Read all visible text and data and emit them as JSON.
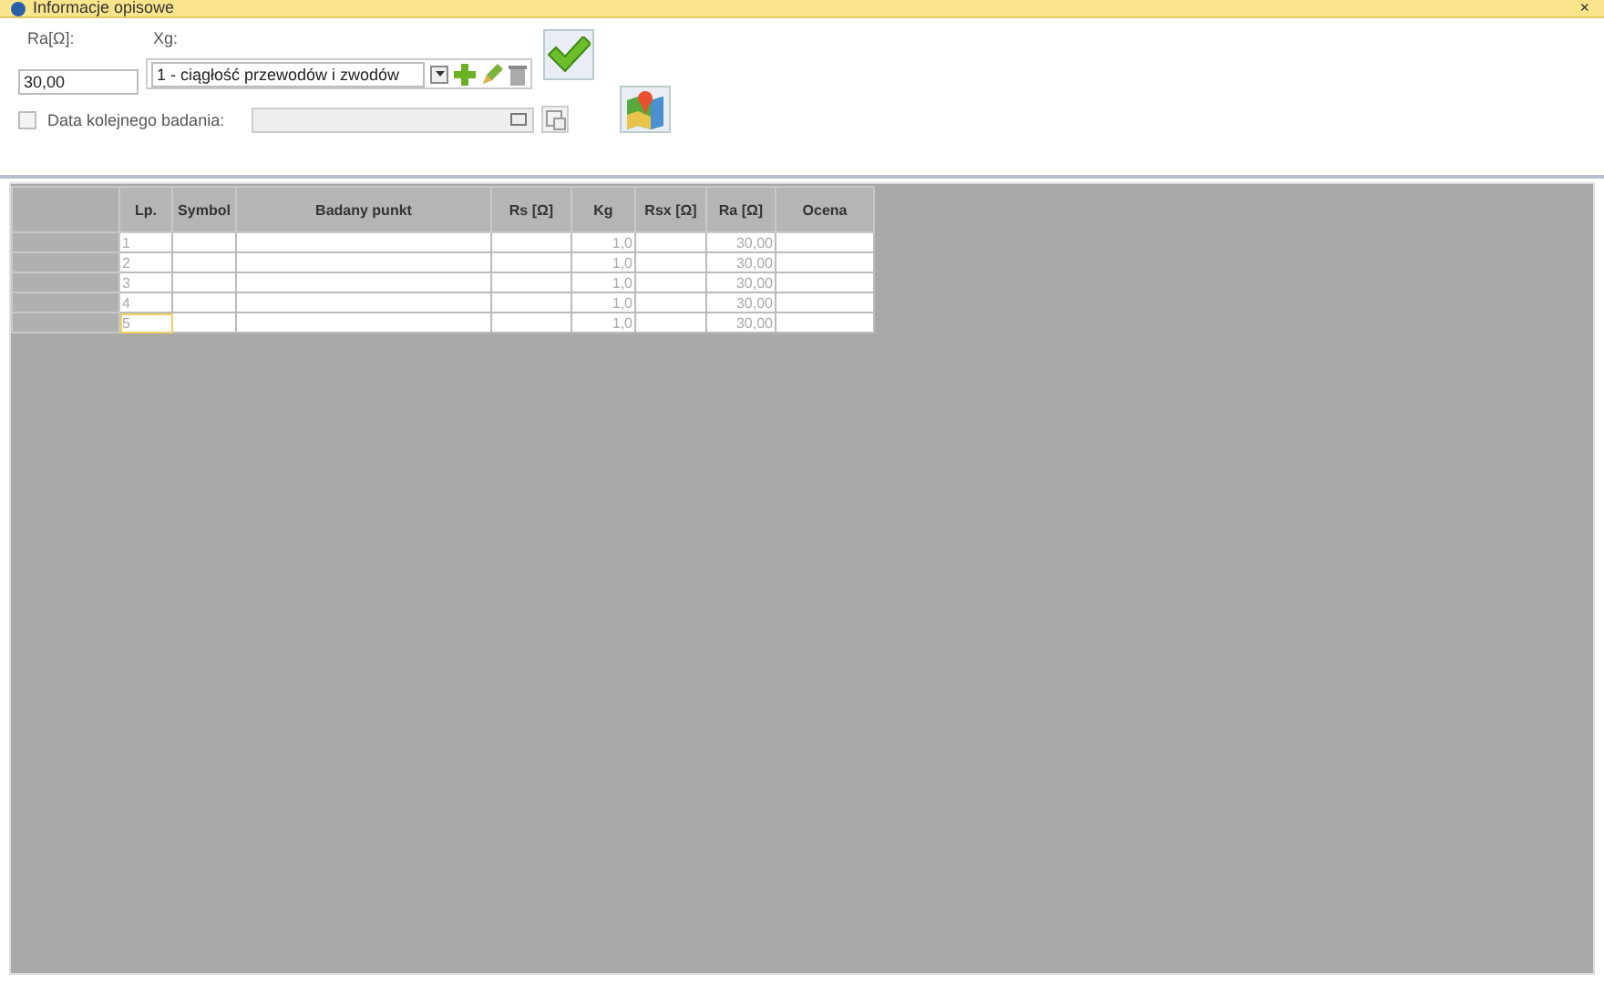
{
  "window": {
    "title": "Informacje opisowe",
    "close": "×"
  },
  "form": {
    "ra_label": "Ra[Ω]:",
    "ra_value": "30,00",
    "xg_label": "Xg:",
    "xg_value": "1 - ciągłość przewodów i zwodów",
    "next_date": {
      "label": "Data kolejnego badania:",
      "checked": false
    }
  },
  "table": {
    "columns": [
      "Lp.",
      "Symbol",
      "Badany punkt",
      "Rs [Ω]",
      "Kg",
      "Rsx [Ω]",
      "Ra [Ω]",
      "Ocena"
    ],
    "rows": [
      {
        "lp": "1",
        "kg": "1,0",
        "ra": "30,00",
        "selected": false
      },
      {
        "lp": "2",
        "kg": "1,0",
        "ra": "30,00",
        "selected": false
      },
      {
        "lp": "3",
        "kg": "1,0",
        "ra": "30,00",
        "selected": false
      },
      {
        "lp": "4",
        "kg": "1,0",
        "ra": "30,00",
        "selected": false
      },
      {
        "lp": "5",
        "kg": "1,0",
        "ra": "30,00",
        "selected": true
      }
    ]
  }
}
